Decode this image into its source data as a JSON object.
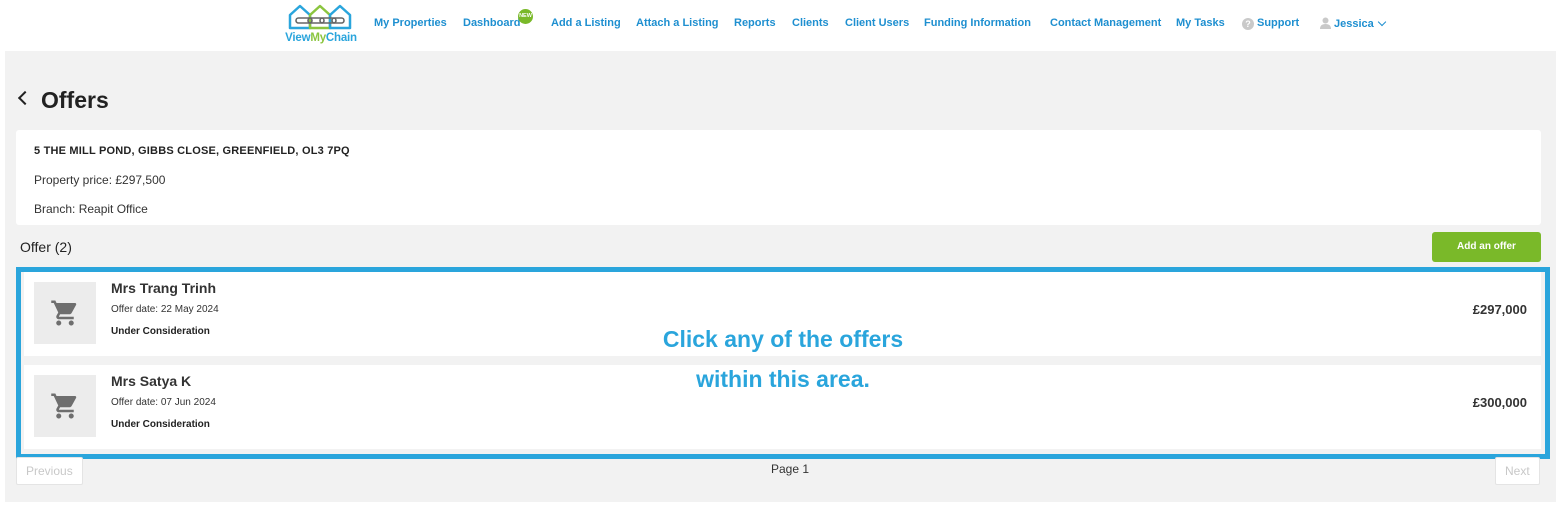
{
  "brand": {
    "name_part1": "View",
    "name_part2": "My",
    "name_part3": "Chain",
    "color_blue": "#2aa5dc",
    "color_green": "#8bc53f"
  },
  "nav": {
    "my_properties": "My Properties",
    "dashboard": "Dashboard",
    "dashboard_badge": "NEW",
    "add_listing": "Add a Listing",
    "attach_listing": "Attach a Listing",
    "reports": "Reports",
    "clients": "Clients",
    "client_users": "Client Users",
    "funding_information": "Funding Information",
    "contact_management": "Contact Management",
    "my_tasks": "My Tasks",
    "support": "Support",
    "user": "Jessica"
  },
  "page": {
    "title": "Offers"
  },
  "property": {
    "address": "5 THE MILL POND, GIBBS CLOSE, GREENFIELD, OL3 7PQ",
    "price": "Property price: £297,500",
    "branch": "Branch: Reapit Office"
  },
  "offers_section": {
    "count_label": "Offer (2)",
    "add_button": "Add an offer"
  },
  "offers": [
    {
      "name": "Mrs Trang Trinh",
      "date": "Offer date: 22 May 2024",
      "status": "Under Consideration",
      "amount": "£297,000",
      "icon": "shopping-cart-icon"
    },
    {
      "name": "Mrs Satya K",
      "date": "Offer date: 07 Jun 2024",
      "status": "Under Consideration",
      "amount": "£300,000",
      "icon": "shopping-cart-icon"
    }
  ],
  "annotation": {
    "line1": "Click any of the offers",
    "line2": "within this area."
  },
  "pagination": {
    "previous": "Previous",
    "page": "Page 1",
    "next": "Next"
  },
  "colors": {
    "accent_green": "#7ab929",
    "link_blue": "#1e8fd0",
    "highlight_blue": "#2aa5dc",
    "panel_grey": "#f2f2f2"
  }
}
